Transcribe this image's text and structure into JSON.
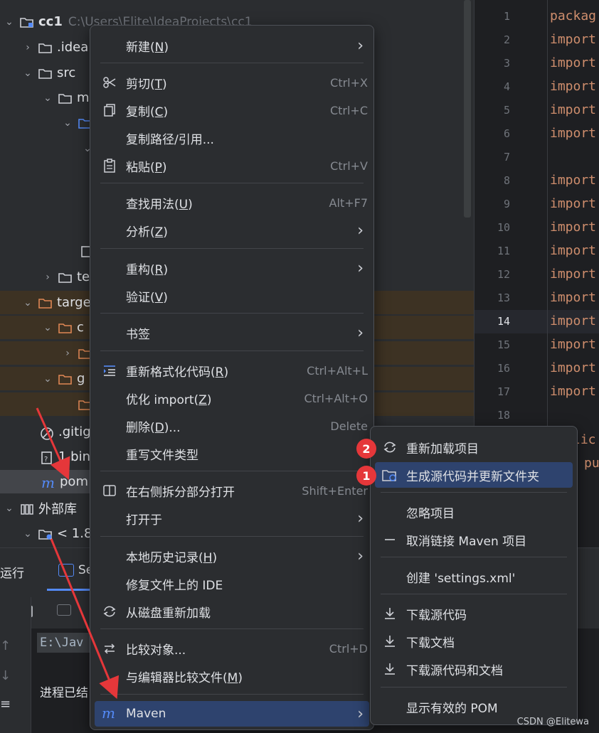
{
  "tree": {
    "rows": [
      {
        "label": "cc1",
        "path": "C:\\Users\\Elite\\IdeaProjects\\cc1"
      },
      {
        "label": ".idea"
      },
      {
        "label": "src"
      },
      {
        "label": "m"
      },
      {
        "label": "te"
      },
      {
        "label": "targe"
      },
      {
        "label": "c"
      },
      {
        "label": "g"
      },
      {
        "label": ".gitig"
      },
      {
        "label": "1.bin"
      },
      {
        "label": "pom"
      },
      {
        "label": "外部库"
      },
      {
        "label": "< 1.8"
      }
    ]
  },
  "editor": {
    "line_numbers": [
      "1",
      "2",
      "3",
      "4",
      "5",
      "6",
      "7",
      "8",
      "9",
      "10",
      "11",
      "12",
      "13",
      "14",
      "15",
      "16",
      "17",
      "18"
    ],
    "code_lines": [
      "packag",
      "import",
      "import",
      "import",
      "import",
      "import",
      "",
      "import",
      "import",
      "import",
      "import",
      "import",
      "import",
      "import",
      "import",
      "import",
      "import",
      ""
    ],
    "extra_lines": [
      "lic",
      "pu"
    ]
  },
  "bottom": {
    "run_tab": "运行",
    "second_tab": "Se",
    "console_lines": [
      "E:\\Jav",
      "进程已结"
    ]
  },
  "context_menu": {
    "items": [
      {
        "label": "新建(N)",
        "shortcut": "",
        "submenu": true,
        "icon": ""
      },
      {
        "label": "剪切(T)",
        "shortcut": "Ctrl+X",
        "icon": "scissors-icon"
      },
      {
        "label": "复制(C)",
        "shortcut": "Ctrl+C",
        "icon": "copy-icon"
      },
      {
        "label": "复制路径/引用...",
        "shortcut": "",
        "icon": ""
      },
      {
        "label": "粘贴(P)",
        "shortcut": "Ctrl+V",
        "icon": "paste-icon"
      },
      {
        "label": "查找用法(U)",
        "shortcut": "Alt+F7",
        "icon": ""
      },
      {
        "label": "分析(Z)",
        "shortcut": "",
        "submenu": true,
        "icon": ""
      },
      {
        "label": "重构(R)",
        "shortcut": "",
        "submenu": true,
        "icon": ""
      },
      {
        "label": "验证(V)",
        "shortcut": "",
        "icon": ""
      },
      {
        "label": "书签",
        "shortcut": "",
        "submenu": true,
        "icon": ""
      },
      {
        "label": "重新格式化代码(R)",
        "shortcut": "Ctrl+Alt+L",
        "icon": "reformat-icon"
      },
      {
        "label": "优化 import(Z)",
        "shortcut": "Ctrl+Alt+O",
        "icon": ""
      },
      {
        "label": "删除(D)...",
        "shortcut": "Delete",
        "icon": ""
      },
      {
        "label": "重写文件类型",
        "shortcut": "",
        "icon": ""
      },
      {
        "label": "在右侧拆分部分打开",
        "shortcut": "Shift+Enter",
        "icon": "split-icon"
      },
      {
        "label": "打开于",
        "shortcut": "",
        "submenu": true,
        "icon": ""
      },
      {
        "label": "本地历史记录(H)",
        "shortcut": "",
        "submenu": true,
        "icon": ""
      },
      {
        "label": "修复文件上的 IDE",
        "shortcut": "",
        "icon": ""
      },
      {
        "label": "从磁盘重新加载",
        "shortcut": "",
        "icon": "reload-icon"
      },
      {
        "label": "比较对象...",
        "shortcut": "Ctrl+D",
        "icon": "compare-icon"
      },
      {
        "label": "与编辑器比较文件(M)",
        "shortcut": "",
        "icon": ""
      },
      {
        "label": "Maven",
        "shortcut": "",
        "submenu": true,
        "icon": "maven-icon"
      }
    ]
  },
  "maven_menu": {
    "items": [
      {
        "label": "重新加载项目",
        "icon": "reload-icon",
        "badge": "2"
      },
      {
        "label": "生成源代码并更新文件夹",
        "icon": "generate-sources-icon",
        "badge": "1"
      },
      {
        "label": "忽略项目",
        "icon": ""
      },
      {
        "label": "取消链接 Maven 项目",
        "icon": "unlink-icon"
      },
      {
        "label": "创建 'settings.xml'",
        "icon": ""
      },
      {
        "label": "下载源代码",
        "icon": "download-icon"
      },
      {
        "label": "下载文档",
        "icon": "download-icon"
      },
      {
        "label": "下载源代码和文档",
        "icon": "download-icon"
      },
      {
        "label": "显示有效的 POM",
        "icon": ""
      }
    ]
  },
  "watermark": "CSDN @Elitewa",
  "colors": {
    "highlight": "#2e436e",
    "badge": "#e5373a",
    "arrow": "#e5373a",
    "excluded_folder_bg": "#3d3223",
    "keyword": "#cf8e6d"
  }
}
